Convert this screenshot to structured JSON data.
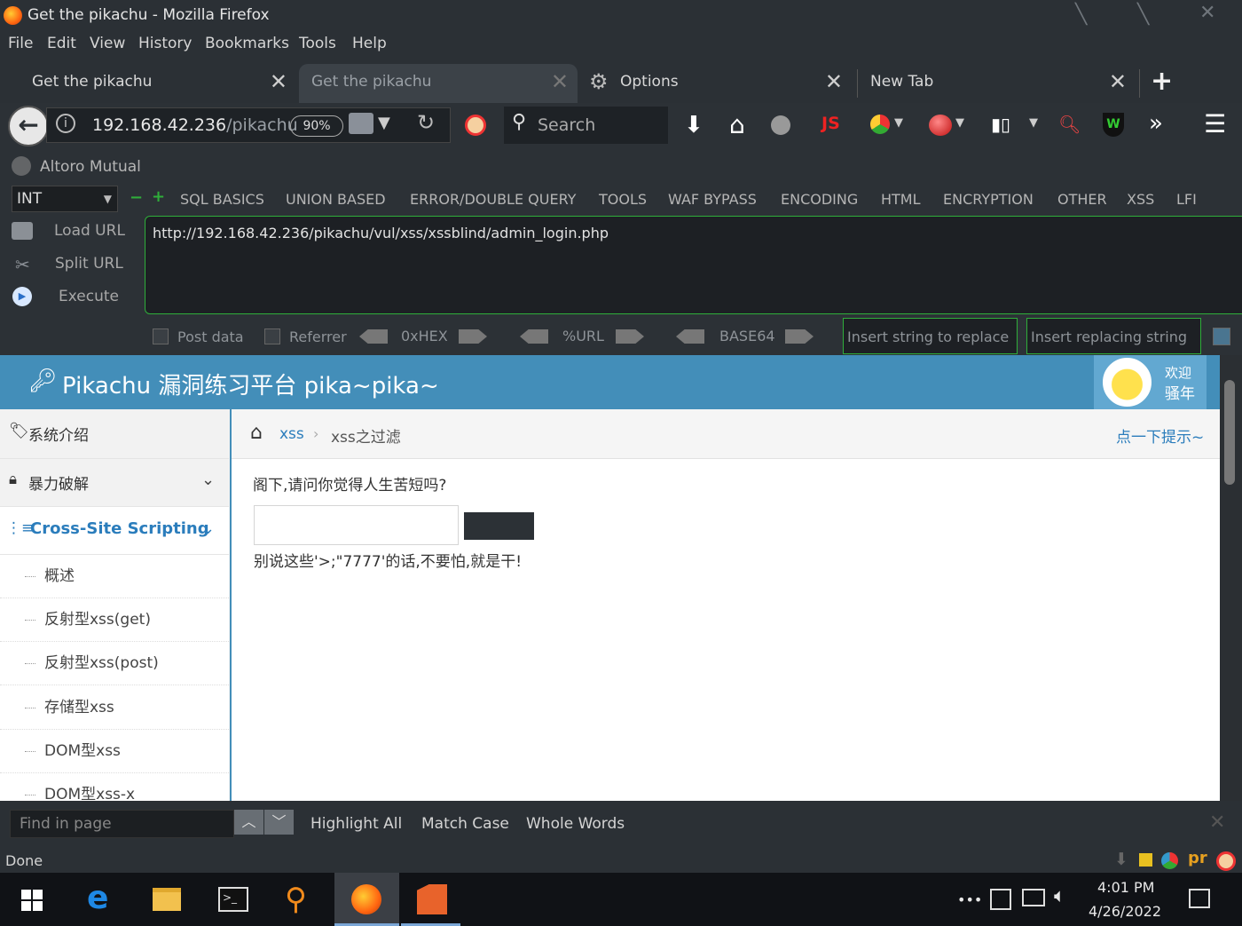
{
  "window": {
    "title": "Get the pikachu - Mozilla Firefox"
  },
  "menu": [
    "File",
    "Edit",
    "View",
    "History",
    "Bookmarks",
    "Tools",
    "Help"
  ],
  "tabs": [
    {
      "label": "Get the pikachu",
      "active": false
    },
    {
      "label": "Get the pikachu",
      "active": true
    },
    {
      "label": "Options",
      "active": false
    },
    {
      "label": "New Tab",
      "active": false
    }
  ],
  "nav": {
    "url_host": "192.168.42.236",
    "url_path": "/pikachu",
    "zoom": "90%",
    "search_placeholder": "Search"
  },
  "bookmarks": {
    "item": "Altoro Mutual"
  },
  "hackbar": {
    "type_select": "INT",
    "menus": [
      "SQL BASICS",
      "UNION BASED",
      "ERROR/DOUBLE QUERY",
      "TOOLS",
      "WAF BYPASS",
      "ENCODING",
      "HTML",
      "ENCRYPTION",
      "OTHER",
      "XSS",
      "LFI"
    ],
    "load_url": "Load URL",
    "split_url": "Split URL",
    "execute": "Execute",
    "url_value": "http://192.168.42.236/pikachu/vul/xss/xssblind/admin_login.php",
    "post_data": "Post data",
    "referrer": "Referrer",
    "hex": "0xHEX",
    "urlenc": "%URL",
    "base64": "BASE64",
    "replace_placeholder": "Insert string to replace",
    "replacing_placeholder": "Insert replacing string"
  },
  "site": {
    "title": "Pikachu 漏洞练习平台 pika~pika~",
    "welcome_line1": "欢迎",
    "welcome_line2": "骚年",
    "sidebar": [
      {
        "label": "系统介绍"
      },
      {
        "label": "暴力破解"
      },
      {
        "label": "Cross-Site Scripting"
      }
    ],
    "subitems": [
      "概述",
      "反射型xss(get)",
      "反射型xss(post)",
      "存储型xss",
      "DOM型xss",
      "DOM型xss-x"
    ],
    "breadcrumb_link": "xss",
    "breadcrumb_current": "xss之过滤",
    "hint": "点一下提示~",
    "question": "阁下,请问你觉得人生苦短吗?",
    "input_value": "",
    "submit_label": "",
    "message": "别说这些'>;\"7777'的话,不要怕,就是干!"
  },
  "find": {
    "placeholder": "Find in page",
    "highlight_all": "Highlight All",
    "match_case": "Match Case",
    "whole_words": "Whole Words"
  },
  "status": {
    "text": "Done"
  },
  "taskbar": {
    "time": "4:01 PM",
    "date": "4/26/2022",
    "more": "•••"
  },
  "colors": {
    "site_header": "#438eb9",
    "chrome_bg": "#2c3136",
    "accent_green": "#2fae3a"
  }
}
